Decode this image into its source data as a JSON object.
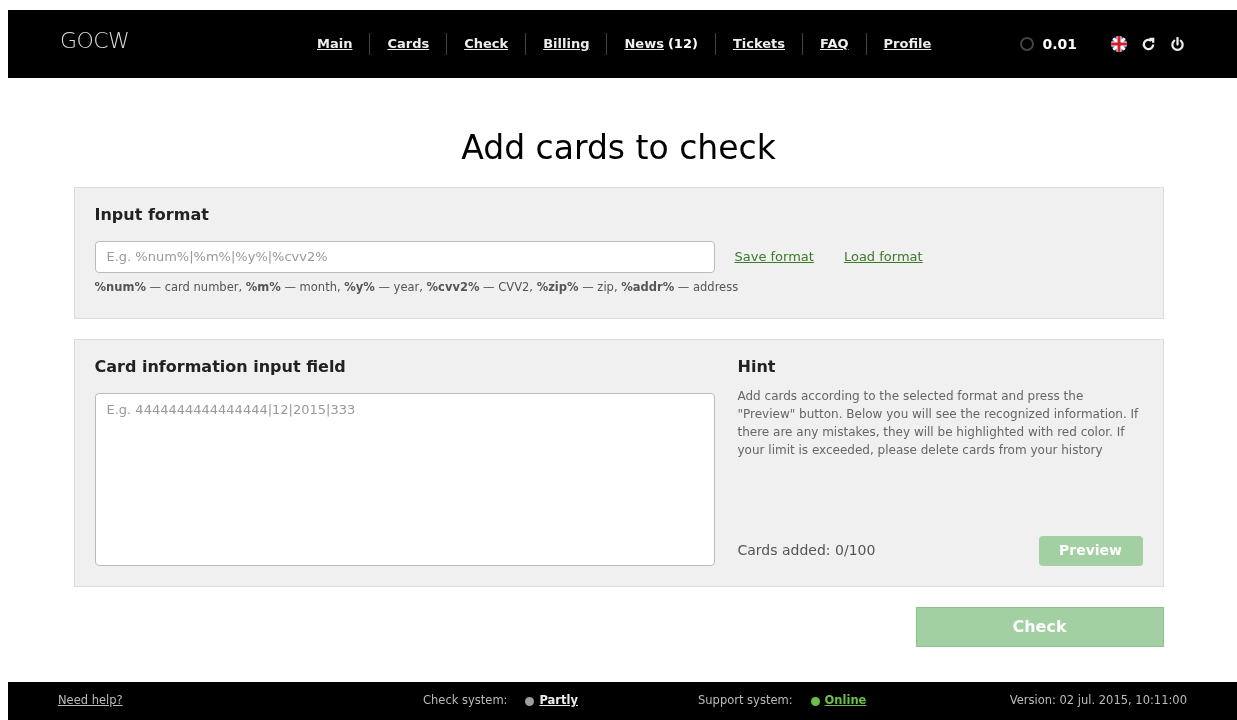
{
  "header": {
    "logo": "GOCW",
    "nav": [
      {
        "label": "Main"
      },
      {
        "label": "Cards"
      },
      {
        "label": "Check"
      },
      {
        "label": "Billing"
      },
      {
        "label": "News",
        "count": "(12)"
      },
      {
        "label": "Tickets"
      },
      {
        "label": "FAQ"
      },
      {
        "label": "Profile"
      }
    ],
    "balance": "0.01"
  },
  "title": "Add cards to check",
  "format_panel": {
    "heading": "Input format",
    "placeholder": "E.g. %num%|%m%|%y%|%cvv2%",
    "links": [
      "Save format",
      "Load format"
    ],
    "legend": "**%num%** — card number, **%m%** — month, **%y%** — year, **%cvv2%** — CVV2, **%zip%** — zip, **%addr%** — address"
  },
  "input_panel": {
    "heading": "Card information input field",
    "placeholder": "E.g. 4444444444444444|12|2015|333",
    "hint_heading": "Hint",
    "hint": "Add cards according to the selected format and press the \"Preview\" button. Below you will see the recognized information. If there are any mistakes, they will be highlighted with red color. If your limit is exceeded, please delete cards from your history",
    "cards_added": "Cards added: 0/100",
    "preview_button": {
      "label": "Preview",
      "disabled": true
    }
  },
  "check_button": {
    "label": "Check",
    "disabled": true
  },
  "footer": {
    "help": "Need help?",
    "statuses": [
      {
        "label": "Check system:",
        "value": "Partly",
        "color": "#9e9e9e"
      },
      {
        "label": "Support system:",
        "value": "Online",
        "color": "#6cbf4a"
      }
    ],
    "version": "Version: 02 jul. 2015, 10:11:00"
  }
}
